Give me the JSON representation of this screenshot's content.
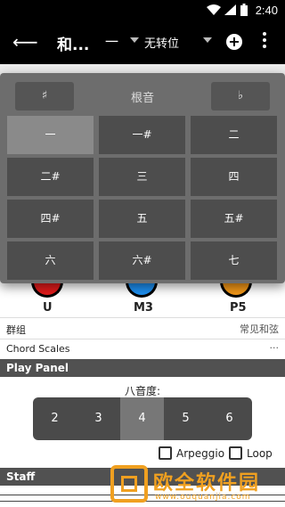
{
  "status": {
    "time": "2:40"
  },
  "appbar": {
    "title": "和...",
    "root_value": "一",
    "transpose": "无转位"
  },
  "notes": {
    "labels": [
      "U",
      "M3",
      "P5"
    ]
  },
  "rows": {
    "group_label": "群组",
    "group_value": "常见和弦",
    "scales_label": "Chord Scales",
    "scales_more": "···"
  },
  "play_panel": {
    "title": "Play Panel",
    "octave_label": "八音度:",
    "octaves": [
      "2",
      "3",
      "4",
      "5",
      "6"
    ],
    "selected_octave": "4",
    "arpeggio": "Arpeggio",
    "loop": "Loop"
  },
  "staff": {
    "title": "Staff"
  },
  "popup": {
    "sharp": "♯",
    "title": "根音",
    "flat": "♭",
    "cells": [
      "一",
      "一#",
      "二",
      "二#",
      "三",
      "四",
      "四#",
      "五",
      "五#",
      "六",
      "六#",
      "七"
    ],
    "selected": "一"
  },
  "watermark": {
    "text": "欧全软件园",
    "url": "www.ouquanjia.com"
  }
}
